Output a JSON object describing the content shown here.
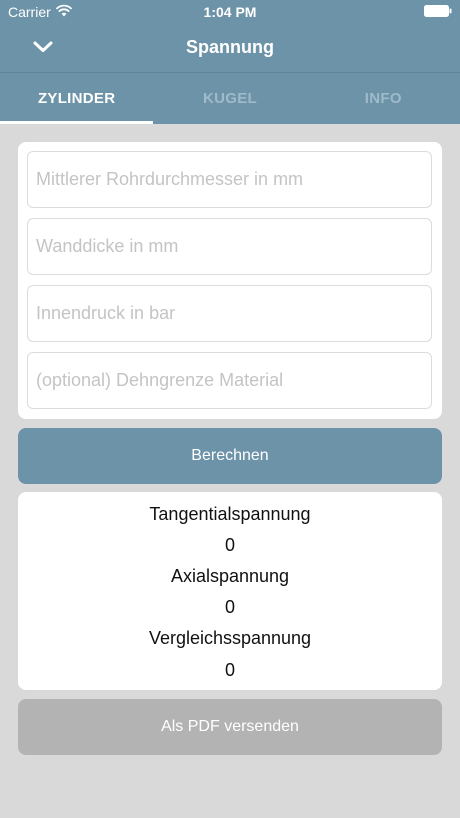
{
  "status_bar": {
    "carrier": "Carrier",
    "time": "1:04 PM",
    "wifi_icon": "wifi-icon",
    "battery_icon": "battery-icon"
  },
  "nav": {
    "title": "Spannung",
    "back_icon": "chevron-down-icon"
  },
  "tabs": [
    {
      "label": "ZYLINDER",
      "active": true
    },
    {
      "label": "KUGEL",
      "active": false
    },
    {
      "label": "INFO",
      "active": false
    }
  ],
  "form": {
    "diameter": {
      "placeholder": "Mittlerer Rohrdurchmesser in mm",
      "value": ""
    },
    "wall_thickness": {
      "placeholder": "Wanddicke in mm",
      "value": ""
    },
    "internal_pressure": {
      "placeholder": "Innendruck in bar",
      "value": ""
    },
    "yield_strength": {
      "placeholder": "(optional) Dehngrenze Material",
      "value": ""
    }
  },
  "calculate_button": {
    "label": "Berechnen"
  },
  "results": {
    "tangential": {
      "label": "Tangentialspannung",
      "value": "0"
    },
    "axial": {
      "label": "Axialspannung",
      "value": "0"
    },
    "equivalent": {
      "label": "Vergleichsspannung",
      "value": "0"
    }
  },
  "pdf_button": {
    "label": "Als PDF versenden"
  },
  "colors": {
    "primary": "#6d93a8",
    "background": "#d9d9d9",
    "tab_inactive": "#9fbac9",
    "disabled_button": "#b3b3b3"
  }
}
